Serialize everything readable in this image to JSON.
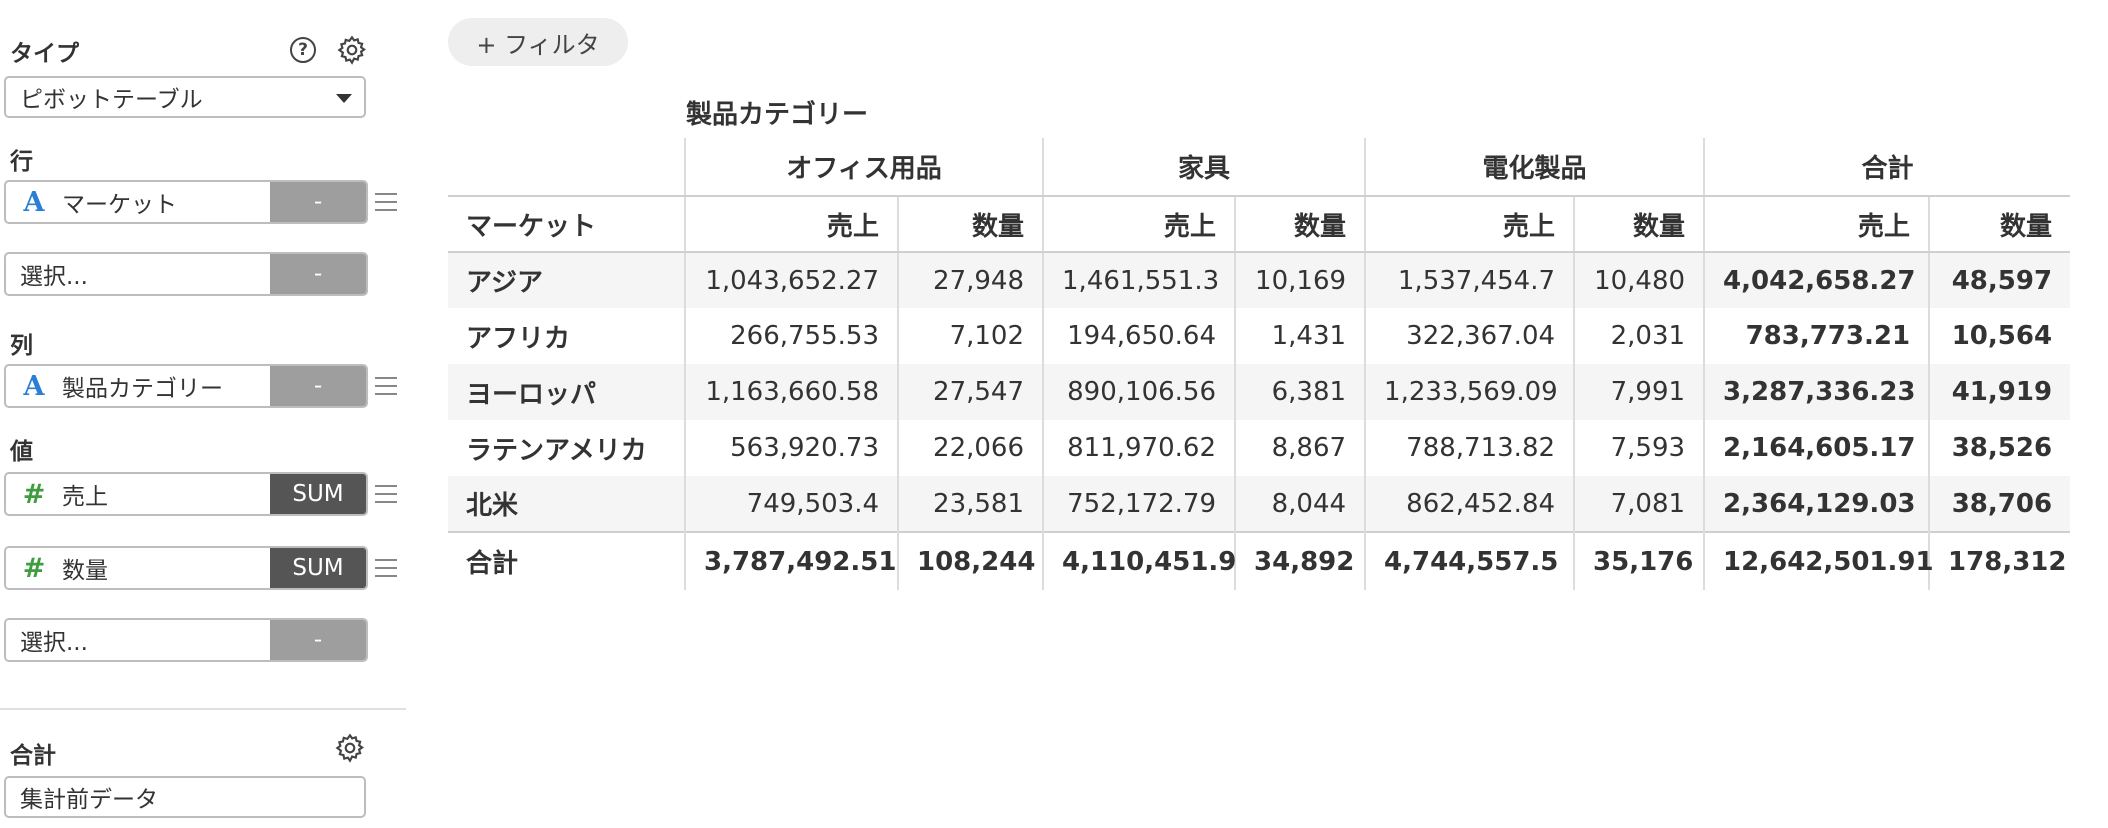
{
  "sidebar": {
    "type_label": "タイプ",
    "type_value": "ピボットテーブル",
    "rows_label": "行",
    "rows": [
      {
        "name": "マーケット",
        "type_icon": "A",
        "agg": "-"
      },
      {
        "name": "選択...",
        "type_icon": "",
        "agg": "-"
      }
    ],
    "columns_label": "列",
    "columns": [
      {
        "name": "製品カテゴリー",
        "type_icon": "A",
        "agg": "-"
      }
    ],
    "values_label": "値",
    "values": [
      {
        "name": "売上",
        "type_icon": "#",
        "agg": "SUM"
      },
      {
        "name": "数量",
        "type_icon": "#",
        "agg": "SUM"
      },
      {
        "name": "選択...",
        "type_icon": "",
        "agg": "-"
      }
    ],
    "total_label": "合計",
    "total_value": "集計前データ",
    "help_icon_glyph": "?"
  },
  "toolbar": {
    "filter_label": "+ フィルタ"
  },
  "pivot": {
    "column_field": "製品カテゴリー",
    "row_field": "マーケット",
    "groups": [
      "オフィス用品",
      "家具",
      "電化製品",
      "合計"
    ],
    "measures": [
      "売上",
      "数量"
    ],
    "rows": [
      {
        "label": "アジア",
        "cells": [
          "1,043,652.27",
          "27,948",
          "1,461,551.3",
          "10,169",
          "1,537,454.7",
          "10,480",
          "4,042,658.27",
          "48,597"
        ]
      },
      {
        "label": "アフリカ",
        "cells": [
          "266,755.53",
          "7,102",
          "194,650.64",
          "1,431",
          "322,367.04",
          "2,031",
          "783,773.21",
          "10,564"
        ]
      },
      {
        "label": "ヨーロッパ",
        "cells": [
          "1,163,660.58",
          "27,547",
          "890,106.56",
          "6,381",
          "1,233,569.09",
          "7,991",
          "3,287,336.23",
          "41,919"
        ]
      },
      {
        "label": "ラテンアメリカ",
        "cells": [
          "563,920.73",
          "22,066",
          "811,970.62",
          "8,867",
          "788,713.82",
          "7,593",
          "2,164,605.17",
          "38,526"
        ]
      },
      {
        "label": "北米",
        "cells": [
          "749,503.4",
          "23,581",
          "752,172.79",
          "8,044",
          "862,452.84",
          "7,081",
          "2,364,129.03",
          "38,706"
        ]
      }
    ],
    "total": {
      "label": "合計",
      "cells": [
        "3,787,492.51",
        "108,244",
        "4,110,451.9",
        "34,892",
        "4,744,557.5",
        "35,176",
        "12,642,501.91",
        "178,312"
      ]
    }
  },
  "colors": {
    "text_type": "#2a7fd4",
    "num_type": "#3f9c3f",
    "sum_bg": "#555555",
    "dash_bg": "#9e9e9e"
  }
}
